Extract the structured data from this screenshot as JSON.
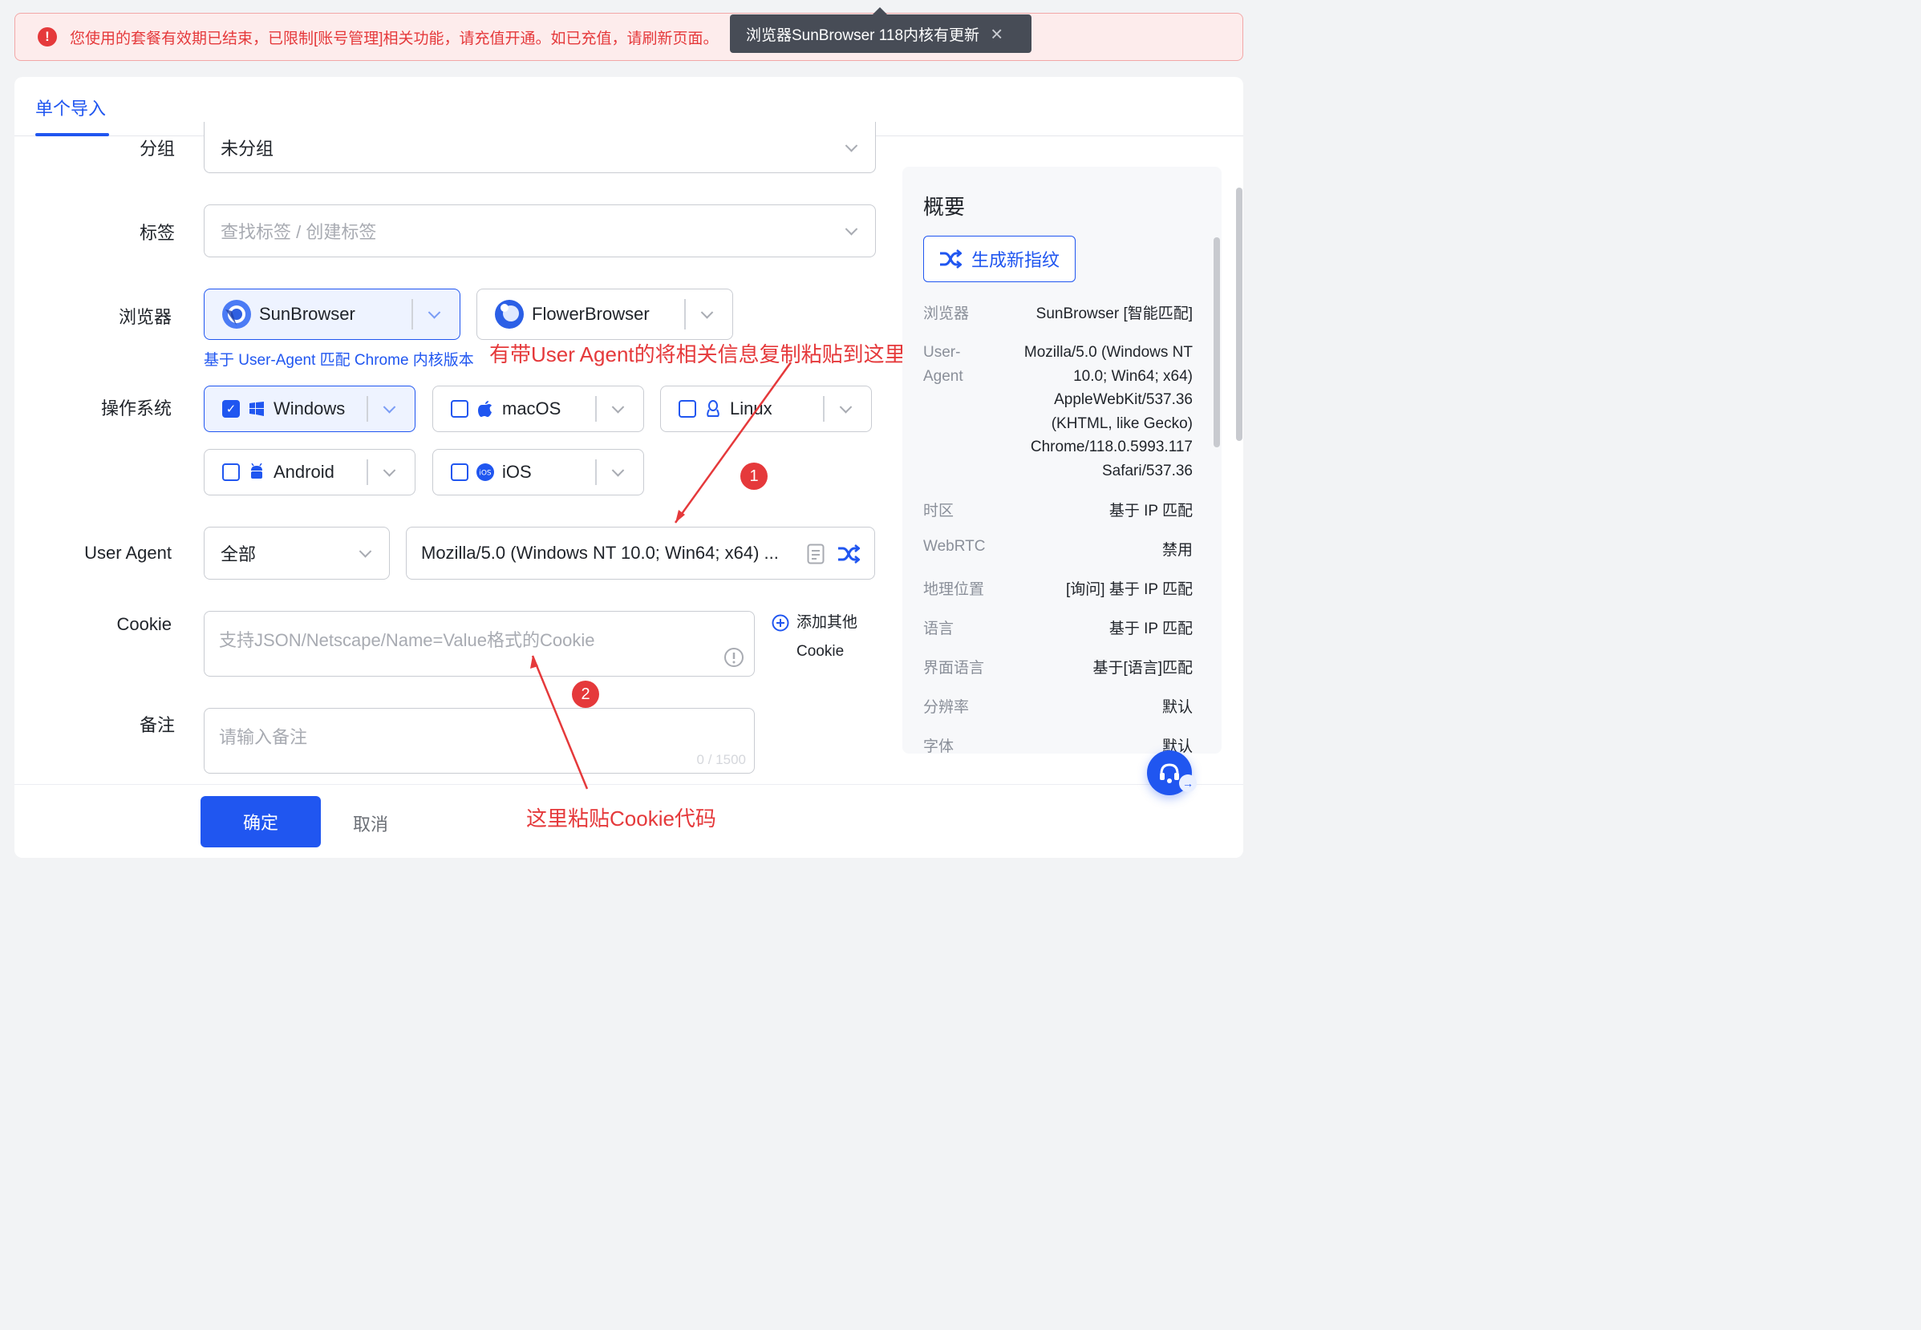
{
  "alert": {
    "text": "您使用的套餐有效期已结束，已限制[账号管理]相关功能，请充值开通。如已充值，请刷新页面。"
  },
  "toast": {
    "text": "浏览器SunBrowser 118内核有更新"
  },
  "tabs": [
    {
      "label": "单个导入"
    }
  ],
  "form": {
    "group": {
      "label": "分组",
      "value": "未分组"
    },
    "tags": {
      "label": "标签",
      "placeholder": "查找标签 / 创建标签"
    },
    "browser": {
      "label": "浏览器",
      "options": [
        {
          "name": "SunBrowser",
          "selected": true
        },
        {
          "name": "FlowerBrowser",
          "selected": false
        }
      ],
      "hint": "基于 User-Agent 匹配 Chrome 内核版本"
    },
    "os": {
      "label": "操作系统",
      "options": [
        {
          "name": "Windows",
          "checked": true
        },
        {
          "name": "macOS",
          "checked": false
        },
        {
          "name": "Linux",
          "checked": false
        },
        {
          "name": "Android",
          "checked": false
        },
        {
          "name": "iOS",
          "checked": false
        }
      ]
    },
    "user_agent": {
      "label": "User Agent",
      "filter": "全部",
      "value": "Mozilla/5.0 (Windows NT 10.0; Win64; x64) ..."
    },
    "cookie": {
      "label": "Cookie",
      "placeholder": "支持JSON/Netscape/Name=Value格式的Cookie",
      "add_other_line1": "添加其他",
      "add_other_line2": "Cookie"
    },
    "note": {
      "label": "备注",
      "placeholder": "请输入备注",
      "counter": "0 / 1500"
    }
  },
  "footer": {
    "ok": "确定",
    "cancel": "取消"
  },
  "annotations": {
    "ua_tip": "有带User Agent的将相关信息复制粘贴到这里",
    "cookie_tip": "这里粘贴Cookie代码",
    "badge1": "1",
    "badge2": "2"
  },
  "summary": {
    "title": "概要",
    "generate": "生成新指纹",
    "rows": [
      {
        "key": "浏览器",
        "value": "SunBrowser [智能匹配]"
      },
      {
        "key1": "User-",
        "key2": "Agent",
        "lines": [
          "Mozilla/5.0 (Windows NT",
          "10.0; Win64; x64)",
          "AppleWebKit/537.36",
          "(KHTML, like Gecko)",
          "Chrome/118.0.5993.117",
          "Safari/537.36"
        ]
      },
      {
        "key": "时区",
        "value": "基于 IP 匹配"
      },
      {
        "key": "WebRTC",
        "value": "禁用"
      },
      {
        "key": "地理位置",
        "value": "[询问] 基于 IP 匹配"
      },
      {
        "key": "语言",
        "value": "基于 IP 匹配"
      },
      {
        "key": "界面语言",
        "value": "基于[语言]匹配"
      },
      {
        "key": "分辨率",
        "value": "默认"
      },
      {
        "key": "字体",
        "value": "默认"
      }
    ]
  },
  "colors": {
    "primary": "#2056f0",
    "danger": "#e5393b",
    "border": "#c9ccd2"
  }
}
